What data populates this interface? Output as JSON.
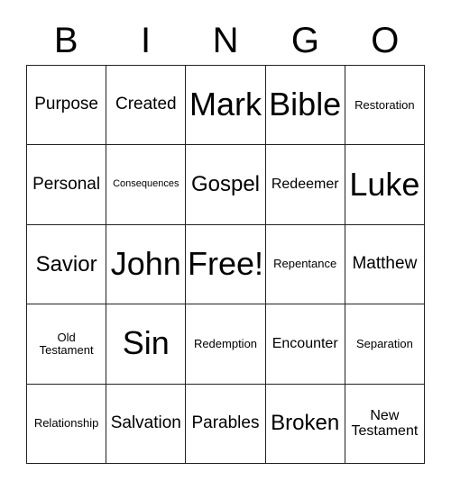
{
  "card": {
    "header": {
      "letters": [
        "B",
        "I",
        "N",
        "G",
        "O"
      ]
    },
    "columns": 5,
    "rows": 5,
    "colors": {
      "background": "#ffffff",
      "border": "#222222",
      "text": "#000000"
    },
    "cells": [
      {
        "label": "Purpose",
        "size": "m",
        "marked": false
      },
      {
        "label": "Created",
        "size": "m",
        "marked": false
      },
      {
        "label": "Mark",
        "size": "xxl",
        "marked": false
      },
      {
        "label": "Bible",
        "size": "xxl",
        "marked": false
      },
      {
        "label": "Restoration",
        "size": "xs",
        "marked": false
      },
      {
        "label": "Personal",
        "size": "m",
        "marked": false
      },
      {
        "label": "Consequences",
        "size": "xxs",
        "marked": false
      },
      {
        "label": "Gospel",
        "size": "l",
        "marked": false
      },
      {
        "label": "Redeemer",
        "size": "s",
        "marked": false
      },
      {
        "label": "Luke",
        "size": "xxl",
        "marked": false
      },
      {
        "label": "Savior",
        "size": "l",
        "marked": false
      },
      {
        "label": "John",
        "size": "xxl",
        "marked": false
      },
      {
        "label": "Free!",
        "size": "xxl",
        "marked": false
      },
      {
        "label": "Repentance",
        "size": "xs",
        "marked": false
      },
      {
        "label": "Matthew",
        "size": "m",
        "marked": false
      },
      {
        "label": "Old Testament",
        "size": "xs",
        "marked": false
      },
      {
        "label": "Sin",
        "size": "xxl",
        "marked": false
      },
      {
        "label": "Redemption",
        "size": "xs",
        "marked": false
      },
      {
        "label": "Encounter",
        "size": "s",
        "marked": false
      },
      {
        "label": "Separation",
        "size": "xs",
        "marked": false
      },
      {
        "label": "Relationship",
        "size": "xs",
        "marked": false
      },
      {
        "label": "Salvation",
        "size": "m",
        "marked": false
      },
      {
        "label": "Parables",
        "size": "m",
        "marked": false
      },
      {
        "label": "Broken",
        "size": "l",
        "marked": false
      },
      {
        "label": "New Testament",
        "size": "s",
        "marked": false
      }
    ]
  }
}
